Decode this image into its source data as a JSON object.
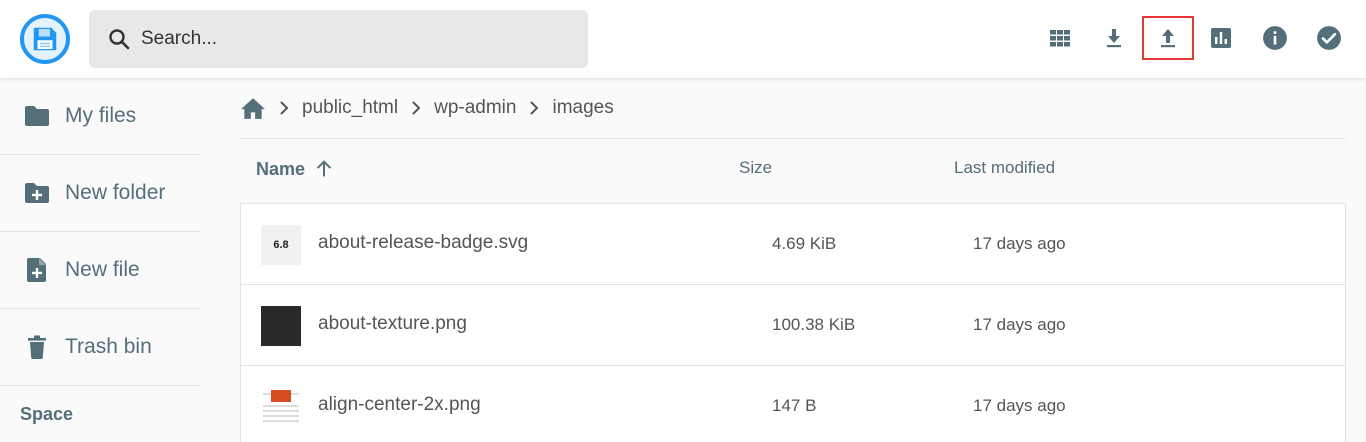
{
  "header": {
    "search_placeholder": "Search...",
    "actions": [
      "grid-view",
      "download",
      "upload",
      "usage-stats",
      "info",
      "select"
    ]
  },
  "sidebar": {
    "items": [
      {
        "label": "My files",
        "icon": "folder-icon"
      },
      {
        "label": "New folder",
        "icon": "folder-plus-icon"
      },
      {
        "label": "New file",
        "icon": "file-plus-icon"
      },
      {
        "label": "Trash bin",
        "icon": "trash-icon"
      }
    ],
    "section_label": "Space"
  },
  "breadcrumb": [
    "public_html",
    "wp-admin",
    "images"
  ],
  "columns": {
    "name": "Name",
    "size": "Size",
    "modified": "Last modified"
  },
  "files": [
    {
      "name": "about-release-badge.svg",
      "size": "4.69 KiB",
      "modified": "17 days ago",
      "thumb_text": "6.8"
    },
    {
      "name": "about-texture.png",
      "size": "100.38 KiB",
      "modified": "17 days ago"
    },
    {
      "name": "align-center-2x.png",
      "size": "147 B",
      "modified": "17 days ago"
    }
  ],
  "colors": {
    "accent": "#2196f3",
    "highlight": "#e53935",
    "icon": "#546e7a"
  }
}
